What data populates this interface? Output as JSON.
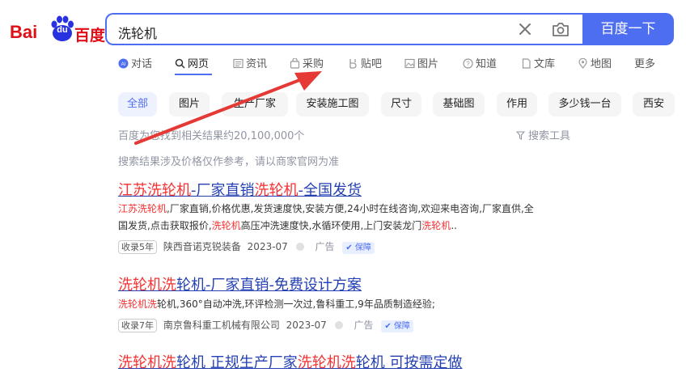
{
  "logo": {
    "left": "Bai",
    "du": "du",
    "right": "百度"
  },
  "search": {
    "query": "洗轮机",
    "button": "百度一下"
  },
  "nav": {
    "tabs": [
      {
        "label": "对话",
        "icon": "ai-icon"
      },
      {
        "label": "网页",
        "icon": "search-icon"
      },
      {
        "label": "资讯",
        "icon": "news-icon"
      },
      {
        "label": "采购",
        "icon": "bag-icon"
      },
      {
        "label": "贴吧",
        "icon": "tieba-icon"
      },
      {
        "label": "图片",
        "icon": "image-icon"
      },
      {
        "label": "知道",
        "icon": "question-icon"
      },
      {
        "label": "文库",
        "icon": "doc-icon"
      },
      {
        "label": "地图",
        "icon": "map-icon"
      },
      {
        "label": "更多",
        "icon": ""
      }
    ]
  },
  "filters": [
    "全部",
    "图片",
    "生产厂家",
    "安装施工图",
    "尺寸",
    "基础图",
    "作用",
    "多少钱一台",
    "西安"
  ],
  "result_count": "百度为您找到相关结果约20,100,000个",
  "search_tools": "搜索工具",
  "notice": "搜索结果涉及价格仅作参考，请以商家官网为准",
  "results": [
    {
      "title_parts": [
        {
          "t": "江苏洗轮机",
          "hl": true
        },
        {
          "t": "-厂家直销",
          "hl": false
        },
        {
          "t": "洗轮机",
          "hl": true
        },
        {
          "t": "-全国发货",
          "hl": false
        }
      ],
      "snippet_line1_parts": [
        {
          "t": "江苏洗轮机",
          "hl": true
        },
        {
          "t": ",厂家直销,价格优惠,发货速度快,安装方便,24小时在线咨询,欢迎来电咨询,厂家直供,全",
          "hl": false
        }
      ],
      "snippet_line2_parts": [
        {
          "t": "国发货,点击获取报价,",
          "hl": false
        },
        {
          "t": "洗轮机",
          "hl": true
        },
        {
          "t": "高压冲洗速度快,水循环使用,上门安装龙门",
          "hl": false
        },
        {
          "t": "洗轮机",
          "hl": true
        },
        {
          "t": "..",
          "hl": false
        }
      ],
      "badge": "收录5年",
      "source": "陕西音诺克锐装备",
      "date": "2023-07",
      "ad": "广告",
      "guarantee": "保障"
    },
    {
      "title_parts": [
        {
          "t": "洗轮机洗",
          "hl": true
        },
        {
          "t": "轮机-厂家直销-免费设计方案",
          "hl": false
        }
      ],
      "snippet_line1_parts": [
        {
          "t": "洗轮机洗",
          "hl": true
        },
        {
          "t": "轮机,360°自动冲洗,环评检测一次过,鲁科重工,9年品质制造经验;",
          "hl": false
        }
      ],
      "badge": "收录7年",
      "source": "南京鲁科重工机械有限公司",
      "date": "2023-07",
      "ad": "广告",
      "guarantee": "保障"
    },
    {
      "title_parts": [
        {
          "t": "洗轮机洗",
          "hl": true
        },
        {
          "t": "轮机 正规生产厂家",
          "hl": false
        },
        {
          "t": "洗轮机洗",
          "hl": true
        },
        {
          "t": "轮机 可按需定做",
          "hl": false
        }
      ]
    }
  ],
  "colors": {
    "accent": "#4e6ef2",
    "highlight": "#f73131",
    "link": "#2440b3",
    "arrow": "#e53935"
  }
}
